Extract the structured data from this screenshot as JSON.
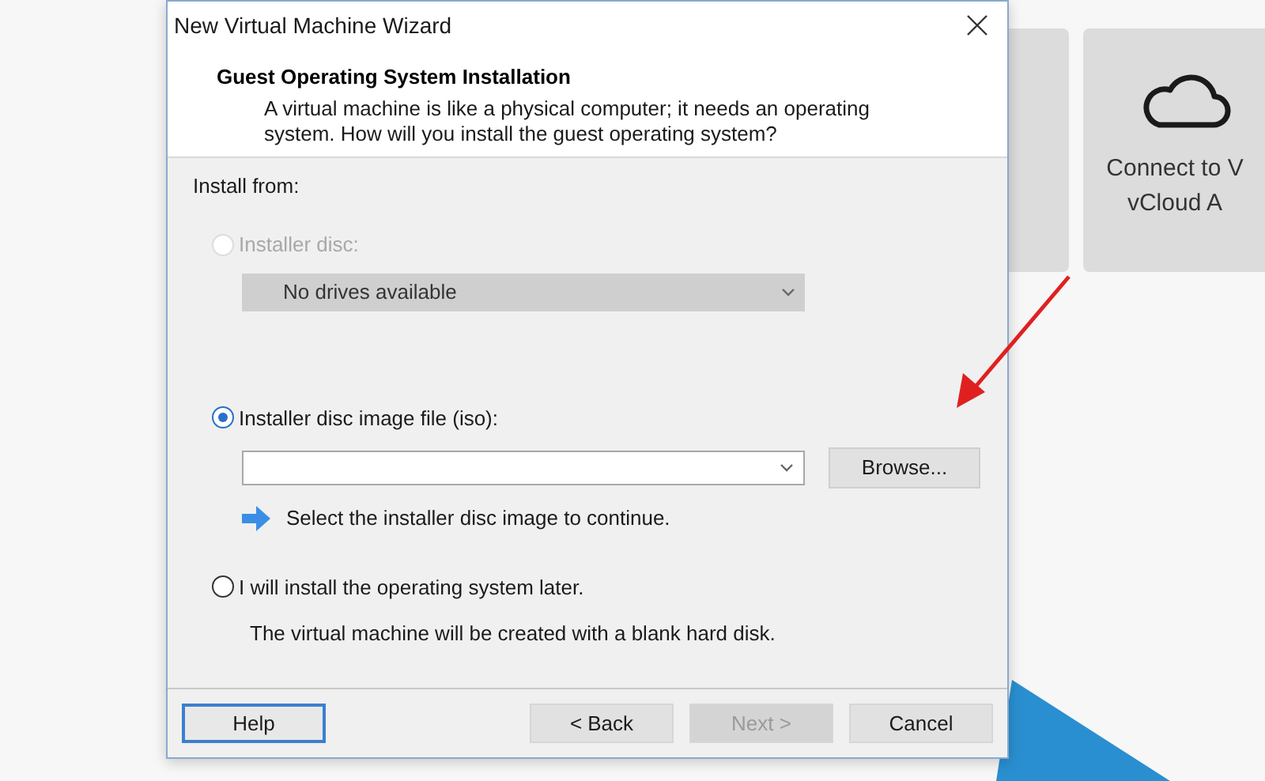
{
  "window": {
    "title": "New Virtual Machine Wizard"
  },
  "header": {
    "title": "Guest Operating System Installation",
    "description": "A virtual machine is like a physical computer; it needs an operating system. How will you install the guest operating system?"
  },
  "install_from": {
    "label": "Install from:"
  },
  "options": [
    {
      "kind": "disc",
      "label": "Installer disc:",
      "selected": false,
      "disabled": true,
      "dropdown": {
        "value": "No drives available",
        "disabled": true
      }
    },
    {
      "kind": "iso",
      "label": "Installer disc image file (iso):",
      "selected": true,
      "disabled": false,
      "button": "Browse...",
      "hint": "Select the installer disc image to continue."
    },
    {
      "kind": "later",
      "label": "I will install the operating system later.",
      "selected": false,
      "disabled": false,
      "note": "The virtual machine will be created with a blank hard disk."
    }
  ],
  "buttons": [
    {
      "kind": "help",
      "label": "Help",
      "disabled": false
    },
    {
      "kind": "nav",
      "label": "< Back",
      "disabled": false
    },
    {
      "kind": "nav",
      "label": "Next >",
      "disabled": true
    },
    {
      "kind": "nav",
      "label": "Cancel",
      "disabled": false
    }
  ],
  "background_card": {
    "lines": [
      "Connect to V",
      "vCloud A"
    ]
  }
}
